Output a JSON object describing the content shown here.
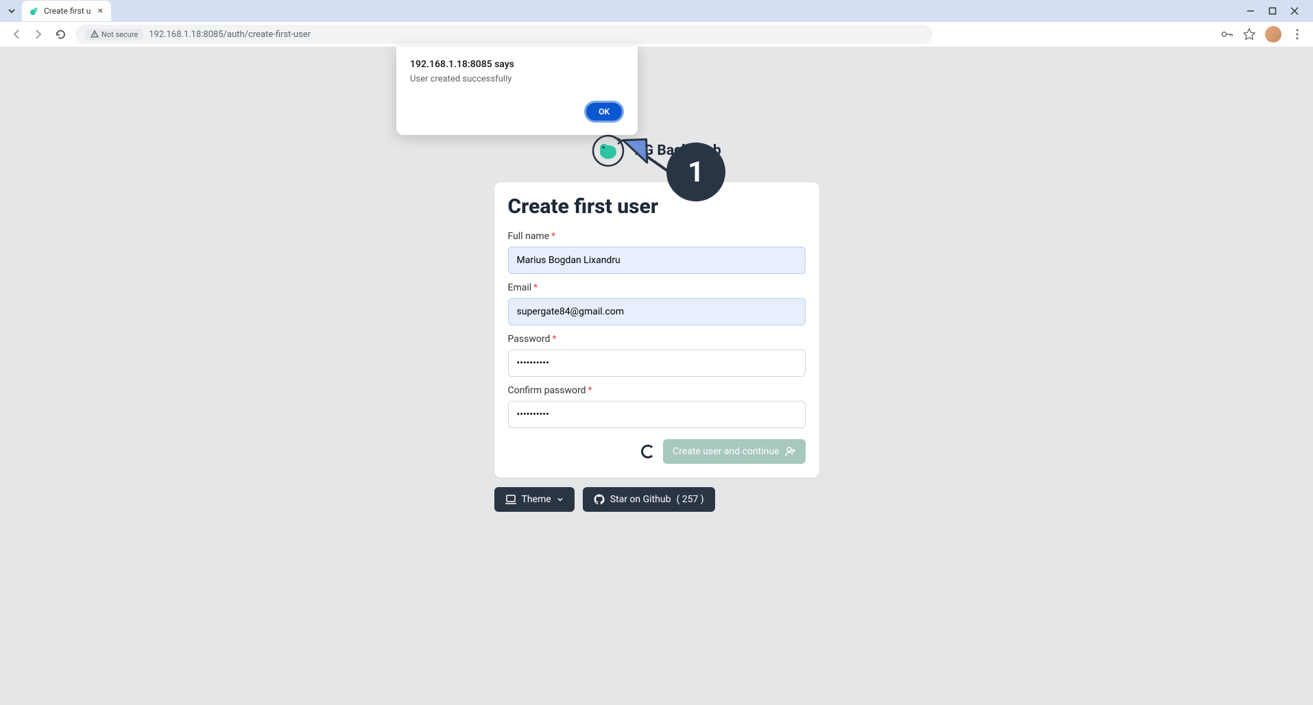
{
  "browser": {
    "tab_title": "Create first u",
    "url": "192.168.1.18:8085/auth/create-first-user",
    "security_label": "Not secure"
  },
  "alert": {
    "origin_says": "192.168.1.18:8085 says",
    "message": "User created successfully",
    "ok_label": "OK"
  },
  "app": {
    "title": "PG Back Web"
  },
  "form": {
    "title": "Create first user",
    "full_name_label": "Full name",
    "full_name_value": "Marius Bogdan Lixandru",
    "email_label": "Email",
    "email_value": "supergate84@gmail.com",
    "password_label": "Password",
    "password_value": "••••••••••",
    "confirm_label": "Confirm password",
    "confirm_value": "••••••••••",
    "submit_label": "Create user and continue"
  },
  "footer": {
    "theme_label": "Theme",
    "github_label": "Star on Github",
    "github_count": "( 257 )"
  },
  "annotation": {
    "badge": "1"
  }
}
